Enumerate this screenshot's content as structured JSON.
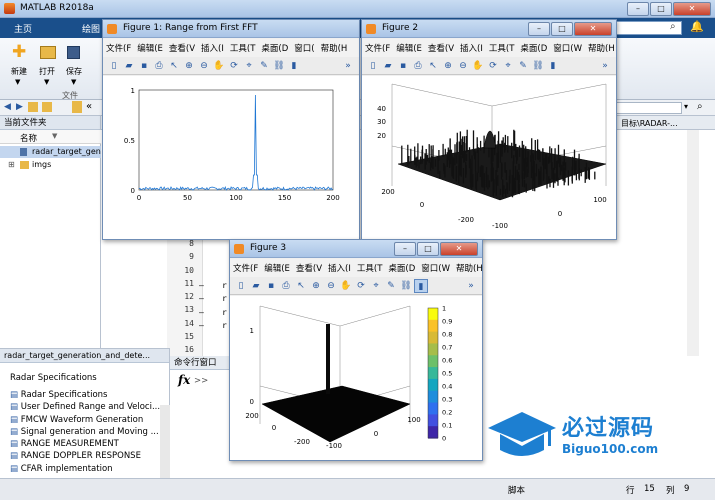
{
  "main": {
    "title": "MATLAB R2018a",
    "tabs": [
      "主页",
      "绘图"
    ],
    "toolstrip": {
      "new": "新建",
      "open": "打开",
      "save": "保存",
      "section": "文件"
    },
    "current_folder_label": "当前文件夹",
    "name_col": "名称",
    "files": [
      "radar_target_gene",
      "imgs"
    ],
    "path_tail": "目标\\RADAR-...",
    "code_lines": [
      "8",
      "9",
      "10",
      "11",
      "12",
      "13",
      "14",
      "15",
      "16"
    ],
    "code_dash_lines": [
      "11",
      "12",
      "13",
      "14"
    ],
    "code_char": "r",
    "cmd_window_label": "命令行窗口",
    "fx": "fx",
    "prompt": ">>",
    "details_title": "radar_target_generation_and_dete...",
    "details_items": [
      "Radar Specifications",
      "Radar Specifications",
      "User Defined Range and Veloci...",
      "FMCW Waveform Generation",
      "Signal generation and Moving ...",
      "RANGE MEASUREMENT",
      "RANGE DOPPLER RESPONSE",
      "CFAR implementation"
    ],
    "status": {
      "script": "脚本",
      "row_label": "行",
      "row": "15",
      "col_label": "列",
      "col": "9"
    }
  },
  "figure1": {
    "title": "Figure 1: Range from First FFT",
    "menu": [
      "文件(F",
      "编辑(E",
      "查看(V",
      "插入(I",
      "工具(T",
      "桌面(D",
      "窗口(",
      "帮助(H"
    ],
    "chart_data": {
      "type": "line",
      "title": "",
      "xlabel": "",
      "ylabel": "",
      "xlim": [
        0,
        200
      ],
      "ylim": [
        0,
        1
      ],
      "xticks": [
        "0",
        "50",
        "100",
        "150",
        "200"
      ],
      "yticks": [
        "0",
        "0.5",
        "1"
      ],
      "peak_x": 120,
      "peak_y": 0.95,
      "noise_level": 0.03
    }
  },
  "figure2": {
    "title": "Figure 2",
    "menu": [
      "文件(F",
      "编辑(E",
      "查看(V",
      "插入(I",
      "工具(T",
      "桌面(D",
      "窗口(W",
      "帮助(H"
    ],
    "chart_data": {
      "type": "surface",
      "zticks": [
        "20",
        "30",
        "40"
      ],
      "yticks": [
        "200",
        "0",
        "-200"
      ],
      "xticks": [
        "-100",
        "0",
        "100"
      ],
      "peak_z": 40
    }
  },
  "figure3": {
    "title": "Figure 3",
    "menu": [
      "文件(F",
      "编辑(E",
      "查看(V",
      "插入(I",
      "工具(T",
      "桌面(D",
      "窗口(W",
      "帮助(H"
    ],
    "chart_data": {
      "type": "surface",
      "zticks": [
        "0",
        "1"
      ],
      "yticks": [
        "200",
        "0",
        "-200"
      ],
      "xticks": [
        "-100",
        "0",
        "100"
      ],
      "colorbar_ticks": [
        "1",
        "0.9",
        "0.8",
        "0.7",
        "0.6",
        "0.5",
        "0.4",
        "0.3",
        "0.2",
        "0.1",
        "0"
      ],
      "colormap": [
        "#f9fb0e",
        "#fac228",
        "#d8ba36",
        "#a6bd4a",
        "#6dc06a",
        "#38b89a",
        "#14a6c0",
        "#1e8ddc",
        "#2f70ef",
        "#4250e0",
        "#3e26a8"
      ]
    }
  },
  "watermark": {
    "brand": "必过源码",
    "url": "Biguo100.com"
  }
}
